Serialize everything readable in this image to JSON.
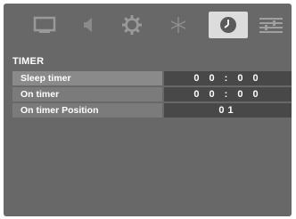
{
  "tabs": [
    {
      "icon": "picture-icon",
      "active": false
    },
    {
      "icon": "sound-icon",
      "active": false
    },
    {
      "icon": "setup-icon",
      "active": false
    },
    {
      "icon": "favorites-icon",
      "active": false
    },
    {
      "icon": "timer-icon",
      "active": true
    },
    {
      "icon": "options-icon",
      "active": false
    }
  ],
  "section_title": "TIMER",
  "items": [
    {
      "label": "Sleep timer",
      "value": "0 0 : 0 0"
    },
    {
      "label": "On timer",
      "value": "0 0 : 0 0"
    },
    {
      "label": "On timer Position",
      "value": "01"
    }
  ],
  "colors": {
    "background": "#686868",
    "label_bg": "#7b7b7b",
    "value_bg": "#484848",
    "active_tab": "#dcdcdc",
    "text": "#ffffff"
  }
}
